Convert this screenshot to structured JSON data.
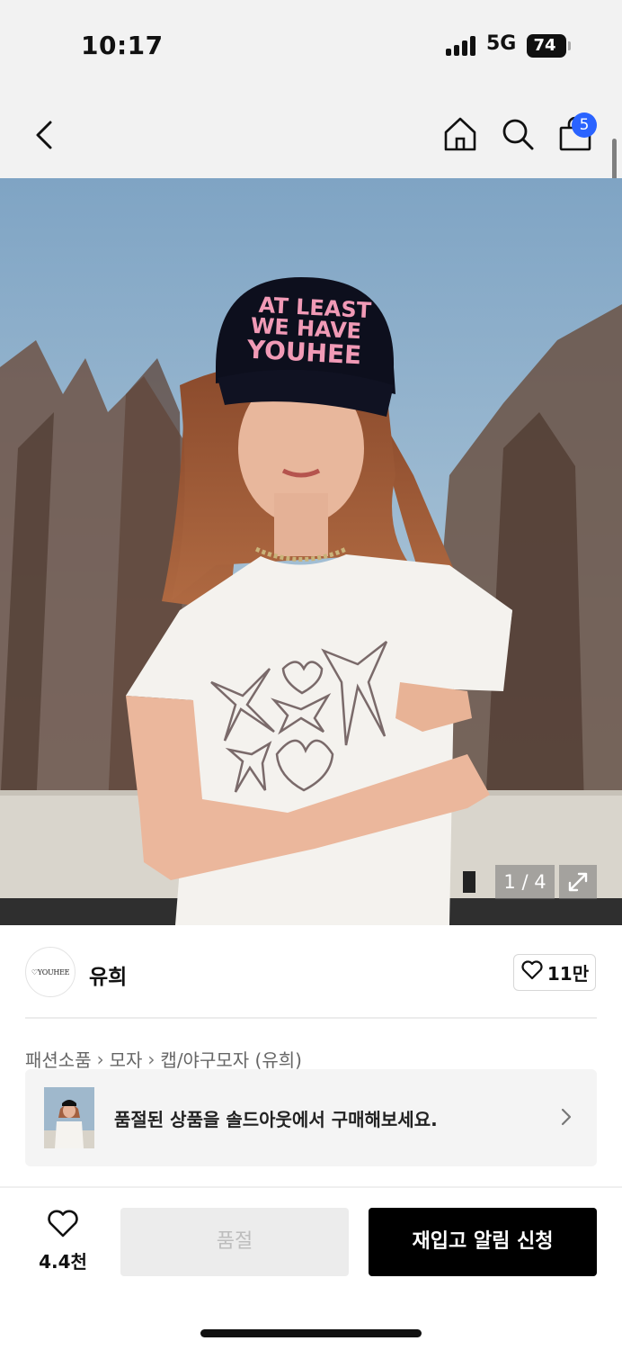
{
  "status_bar": {
    "time": "10:17",
    "network": "5G",
    "battery": "74"
  },
  "nav": {
    "back_icon": "chevron-left-icon",
    "home_icon": "home-icon",
    "search_icon": "search-icon",
    "bag_icon": "shopping-bag-icon",
    "bag_badge": "5",
    "badge_color": "#2a63ff"
  },
  "product_image": {
    "cap_text": [
      "AT LEAST",
      "WE HAVE",
      "YOUHEE"
    ],
    "counter": "1 / 4",
    "expand_icon": "expand-icon"
  },
  "brand": {
    "logo_text": "♡YOUHEE",
    "name": "유희",
    "likes": "11만",
    "like_icon": "heart-outline-icon"
  },
  "breadcrumb": [
    "패션소품",
    "모자",
    "캡/야구모자 (유희)"
  ],
  "soldout_banner": {
    "text": "품절된 상품을 솔드아웃에서 구매해보세요.",
    "chevron_icon": "chevron-right-icon"
  },
  "action_bar": {
    "wish_icon": "heart-outline-icon",
    "wish_count": "4.4천",
    "soldout_label": "품절",
    "restock_label": "재입고 알림 신청"
  },
  "colors": {
    "accent": "#2a63ff",
    "primary_button": "#000000",
    "disabled_button": "#ececec"
  }
}
